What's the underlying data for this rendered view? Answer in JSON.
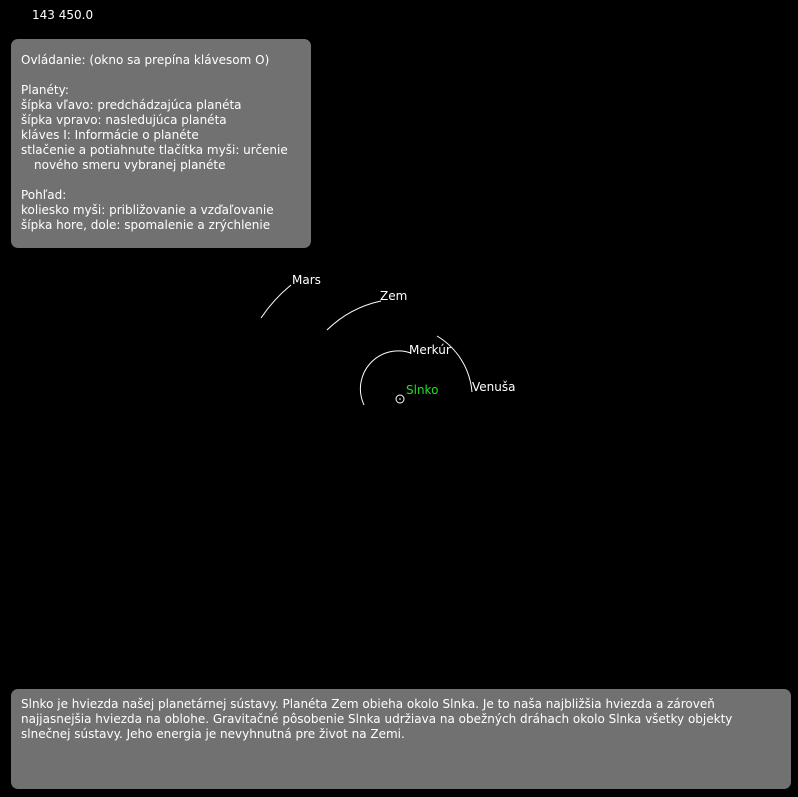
{
  "timer": "143 450.0",
  "controls": {
    "title": "Ovládanie: (okno sa prepína klávesom O)",
    "planets_heading": "Planéty:",
    "planets_items": [
      "šípka vľavo: predchádzajúca planéta",
      "šípka vpravo: nasledujúca planéta",
      "kláves I: Informácie o planéte",
      "stlačenie a potiahnute tlačítka myši: určenie",
      "nového smeru vybranej planéte"
    ],
    "view_heading": "Pohľad:",
    "view_items": [
      "koliesko myši: približovanie a vzďaľovanie",
      "šípka hore, dole: spomalenie a zrýchlenie"
    ]
  },
  "bodies": {
    "sun": "Slnko",
    "mercury": "Merkúr",
    "venus": "Venuša",
    "earth": "Zem",
    "mars": "Mars"
  },
  "colors": {
    "sun_label": "#20e020",
    "panel": "#7d7d7d",
    "orbit": "#ffffff"
  },
  "info": {
    "text": "Slnko je hviezda našej planetárnej sústavy. Planéta Zem obieha okolo Slnka. Je to naša najbližšia hviezda a zároveň najjasnejšia hviezda na oblohe. Gravitačné pôsobenie Slnka udržiava na obežných dráhach okolo Slnka všetky objekty slnečnej sústavy. Jeho energia je nevyhnutná pre život na Zemi."
  }
}
